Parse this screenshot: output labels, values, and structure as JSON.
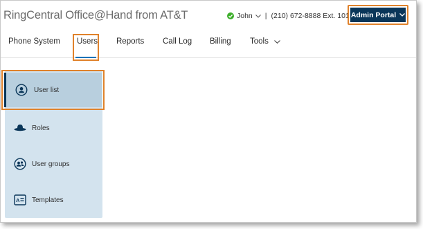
{
  "header": {
    "brand": "RingCentral Office@Hand from AT&T",
    "user_name": "John",
    "separator": "|",
    "phone": "(210) 672-8888 Ext. 101",
    "admin_portal_label": "Admin Portal"
  },
  "nav": {
    "phone_system": "Phone System",
    "users": "Users",
    "reports": "Reports",
    "call_log": "Call Log",
    "billing": "Billing",
    "tools": "Tools",
    "active": "Users"
  },
  "sidebar": {
    "items": [
      {
        "label": "User list",
        "icon": "user-circle-icon",
        "active": true
      },
      {
        "label": "Roles",
        "icon": "hat-icon",
        "active": false
      },
      {
        "label": "User groups",
        "icon": "user-group-icon",
        "active": false
      },
      {
        "label": "Templates",
        "icon": "template-icon",
        "active": false
      }
    ]
  },
  "colors": {
    "highlight_outline": "#e0822b",
    "admin_button": "#0a3659",
    "status_online": "#3dae2b",
    "sidebar_bg": "#d3e3ee",
    "sidebar_active_bg": "#b8cfde",
    "active_underline": "#1a73b8"
  }
}
